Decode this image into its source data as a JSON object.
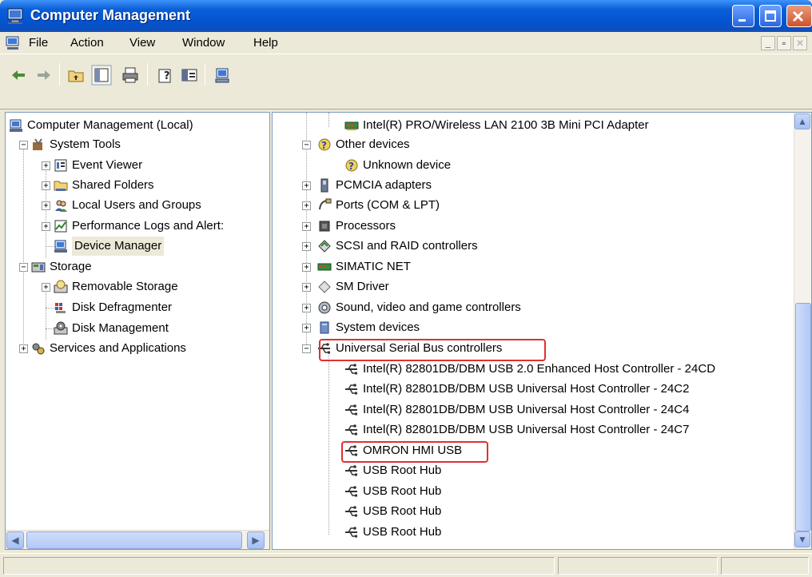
{
  "window": {
    "title": "Computer Management"
  },
  "menu": {
    "items": [
      "File",
      "Action",
      "View",
      "Window",
      "Help"
    ],
    "mdi_buttons": [
      "_",
      "▫",
      "✕"
    ]
  },
  "toolbar": {
    "icons": [
      "back-icon",
      "forward-icon",
      "up-folder-icon",
      "show-hide-tree-icon",
      "print-icon",
      "help-icon",
      "properties-icon",
      "computer-icon"
    ]
  },
  "left_tree": {
    "root": "Computer Management (Local)",
    "system_tools": "System Tools",
    "event_viewer": "Event Viewer",
    "shared_folders": "Shared Folders",
    "local_users": "Local Users and Groups",
    "perf_logs": "Performance Logs and Alert:",
    "device_manager": "Device Manager",
    "storage": "Storage",
    "removable_storage": "Removable Storage",
    "disk_defrag": "Disk Defragmenter",
    "disk_mgmt": "Disk Management",
    "services_apps": "Services and Applications"
  },
  "right_tree": {
    "wireless": "Intel(R) PRO/Wireless LAN 2100 3B Mini PCI Adapter",
    "other_devices": "Other devices",
    "unknown_device": "Unknown device",
    "pcmcia": "PCMCIA adapters",
    "ports": "Ports (COM & LPT)",
    "processors": "Processors",
    "scsi": "SCSI and RAID controllers",
    "simatic": "SIMATIC NET",
    "sm_driver": "SM Driver",
    "sound": "Sound, video and game controllers",
    "system_devices": "System devices",
    "usb_controllers": "Universal Serial Bus controllers",
    "usb_children": [
      "Intel(R) 82801DB/DBM USB 2.0 Enhanced Host Controller - 24CD",
      "Intel(R) 82801DB/DBM USB Universal Host Controller - 24C2",
      "Intel(R) 82801DB/DBM USB Universal Host Controller - 24C4",
      "Intel(R) 82801DB/DBM USB Universal Host Controller - 24C7",
      "OMRON HMI USB",
      "USB Root Hub",
      "USB Root Hub",
      "USB Root Hub",
      "USB Root Hub"
    ]
  },
  "colors": {
    "titlebar": "#0453CF",
    "highlight": "#E03030",
    "selection": "#ECE9D8"
  }
}
